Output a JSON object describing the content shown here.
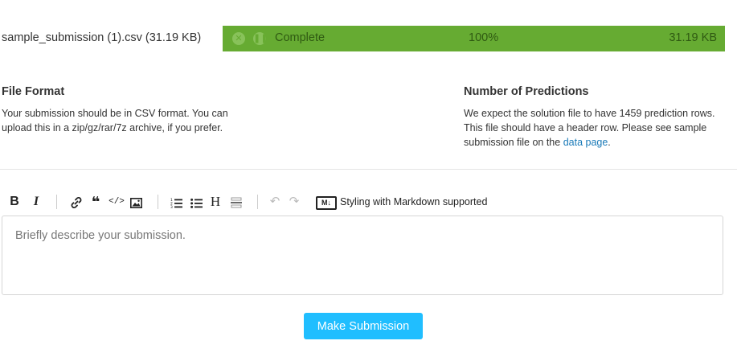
{
  "upload": {
    "file_name": "sample_submission (1).csv (31.19 KB)",
    "status": "Complete",
    "percent": "100%",
    "progress_fraction": 1.0,
    "size": "31.19 KB"
  },
  "file_format": {
    "title": "File Format",
    "body": "Your submission should be in CSV format. You can upload this in a zip/gz/rar/7z archive, if you prefer."
  },
  "predictions": {
    "title": "Number of Predictions",
    "body_before_link": "We expect the solution file to have 1459 prediction rows. This file should have a header row. Please see sample submission file on the ",
    "link_text": "data page",
    "body_after_link": "."
  },
  "toolbar": {
    "bold": "B",
    "italic": "I",
    "heading": "H",
    "markdown_badge": "M↓",
    "markdown_label": "Styling with Markdown supported"
  },
  "description": {
    "placeholder": "Briefly describe your submission.",
    "value": ""
  },
  "submit_label": "Make Submission",
  "colors": {
    "progress_bg": "#66ab32",
    "progress_text": "#2f5a12",
    "accent_button": "#20beff",
    "link": "#1a7ab8"
  }
}
